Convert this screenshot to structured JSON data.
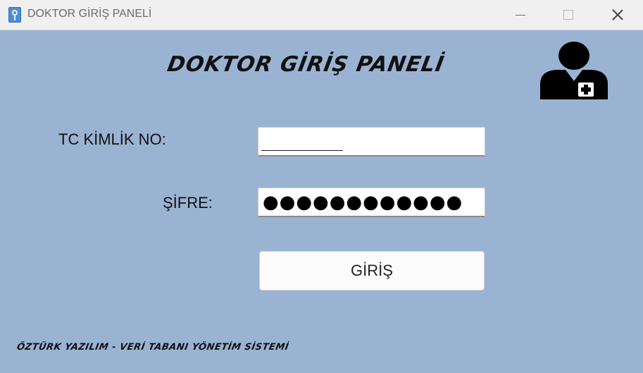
{
  "window": {
    "title": "DOKTOR GİRİŞ PANELİ",
    "app_icon": "app-logo-icon",
    "controls": {
      "minimize": "minimize-icon",
      "maximize": "maximize-icon",
      "close": "close-icon"
    }
  },
  "form": {
    "heading": "DOKTOR GİRİŞ PANELİ",
    "doctor_icon": "doctor-icon",
    "tc_label": "TC KİMLİK NO:",
    "tc_value": "",
    "password_label": "ŞİFRE:",
    "password_value": "●●●●●●●●●●●●",
    "login_button": "GİRİŞ"
  },
  "footer": {
    "text": "ÖZTÜRK YAZILIM - VERİ TABANI YÖNETİM SİSTEMİ"
  },
  "colors": {
    "background": "#9ab3d3",
    "titlebar": "#f0f0f0"
  }
}
